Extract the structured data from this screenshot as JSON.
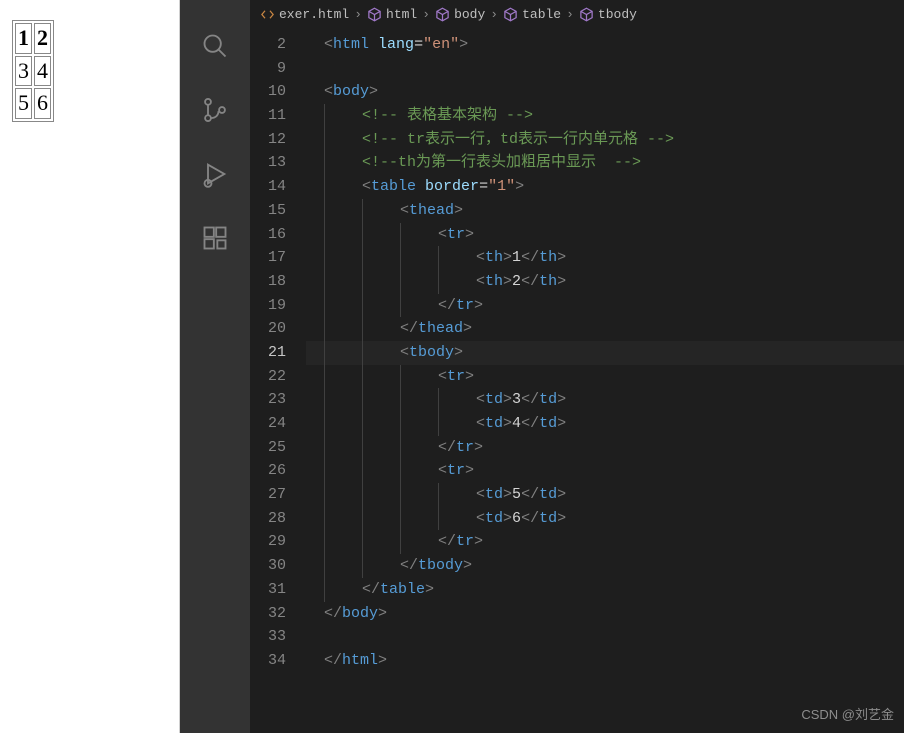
{
  "preview": {
    "table": {
      "header": [
        "1",
        "2"
      ],
      "rows": [
        [
          "3",
          "4"
        ],
        [
          "5",
          "6"
        ]
      ]
    }
  },
  "breadcrumb": {
    "file": "exer.html",
    "path": [
      "html",
      "body",
      "table",
      "tbody"
    ]
  },
  "activity": {
    "icons": [
      "search",
      "source-control",
      "run-debug",
      "extensions"
    ]
  },
  "editor": {
    "active_line": 21,
    "lines": [
      {
        "n": 2,
        "indent": 0,
        "tokens": [
          [
            "brkt",
            "<"
          ],
          [
            "tag",
            "html"
          ],
          [
            "txt",
            " "
          ],
          [
            "attr",
            "lang"
          ],
          [
            "eq",
            "="
          ],
          [
            "str",
            "\"en\""
          ],
          [
            "brkt",
            ">"
          ]
        ]
      },
      {
        "n": 9,
        "indent": 0,
        "tokens": []
      },
      {
        "n": 10,
        "indent": 0,
        "tokens": [
          [
            "brkt",
            "<"
          ],
          [
            "tag",
            "body"
          ],
          [
            "brkt",
            ">"
          ]
        ]
      },
      {
        "n": 11,
        "indent": 1,
        "tokens": [
          [
            "cmt",
            "<!-- 表格基本架构 -->"
          ]
        ]
      },
      {
        "n": 12,
        "indent": 1,
        "tokens": [
          [
            "cmt",
            "<!-- tr表示一行，td表示一行内单元格 -->"
          ]
        ]
      },
      {
        "n": 13,
        "indent": 1,
        "tokens": [
          [
            "cmt",
            "<!--th为第一行表头加粗居中显示  -->"
          ]
        ]
      },
      {
        "n": 14,
        "indent": 1,
        "tokens": [
          [
            "brkt",
            "<"
          ],
          [
            "tag",
            "table"
          ],
          [
            "txt",
            " "
          ],
          [
            "attr",
            "border"
          ],
          [
            "eq",
            "="
          ],
          [
            "str",
            "\"1\""
          ],
          [
            "brkt",
            ">"
          ]
        ]
      },
      {
        "n": 15,
        "indent": 2,
        "tokens": [
          [
            "brkt",
            "<"
          ],
          [
            "tag",
            "thead"
          ],
          [
            "brkt",
            ">"
          ]
        ]
      },
      {
        "n": 16,
        "indent": 3,
        "tokens": [
          [
            "brkt",
            "<"
          ],
          [
            "tag",
            "tr"
          ],
          [
            "brkt",
            ">"
          ]
        ]
      },
      {
        "n": 17,
        "indent": 4,
        "tokens": [
          [
            "brkt",
            "<"
          ],
          [
            "tag",
            "th"
          ],
          [
            "brkt",
            ">"
          ],
          [
            "txt",
            "1"
          ],
          [
            "brkt",
            "</"
          ],
          [
            "tag",
            "th"
          ],
          [
            "brkt",
            ">"
          ]
        ]
      },
      {
        "n": 18,
        "indent": 4,
        "tokens": [
          [
            "brkt",
            "<"
          ],
          [
            "tag",
            "th"
          ],
          [
            "brkt",
            ">"
          ],
          [
            "txt",
            "2"
          ],
          [
            "brkt",
            "</"
          ],
          [
            "tag",
            "th"
          ],
          [
            "brkt",
            ">"
          ]
        ]
      },
      {
        "n": 19,
        "indent": 3,
        "tokens": [
          [
            "brkt",
            "</"
          ],
          [
            "tag",
            "tr"
          ],
          [
            "brkt",
            ">"
          ]
        ]
      },
      {
        "n": 20,
        "indent": 2,
        "tokens": [
          [
            "brkt",
            "</"
          ],
          [
            "tag",
            "thead"
          ],
          [
            "brkt",
            ">"
          ]
        ]
      },
      {
        "n": 21,
        "indent": 2,
        "tokens": [
          [
            "brkt",
            "<"
          ],
          [
            "tag",
            "tbody"
          ],
          [
            "brkt",
            ">"
          ]
        ]
      },
      {
        "n": 22,
        "indent": 3,
        "tokens": [
          [
            "brkt",
            "<"
          ],
          [
            "tag",
            "tr"
          ],
          [
            "brkt",
            ">"
          ]
        ]
      },
      {
        "n": 23,
        "indent": 4,
        "tokens": [
          [
            "brkt",
            "<"
          ],
          [
            "tag",
            "td"
          ],
          [
            "brkt",
            ">"
          ],
          [
            "txt",
            "3"
          ],
          [
            "brkt",
            "</"
          ],
          [
            "tag",
            "td"
          ],
          [
            "brkt",
            ">"
          ]
        ]
      },
      {
        "n": 24,
        "indent": 4,
        "tokens": [
          [
            "brkt",
            "<"
          ],
          [
            "tag",
            "td"
          ],
          [
            "brkt",
            ">"
          ],
          [
            "txt",
            "4"
          ],
          [
            "brkt",
            "</"
          ],
          [
            "tag",
            "td"
          ],
          [
            "brkt",
            ">"
          ]
        ]
      },
      {
        "n": 25,
        "indent": 3,
        "tokens": [
          [
            "brkt",
            "</"
          ],
          [
            "tag",
            "tr"
          ],
          [
            "brkt",
            ">"
          ]
        ]
      },
      {
        "n": 26,
        "indent": 3,
        "tokens": [
          [
            "brkt",
            "<"
          ],
          [
            "tag",
            "tr"
          ],
          [
            "brkt",
            ">"
          ]
        ]
      },
      {
        "n": 27,
        "indent": 4,
        "tokens": [
          [
            "brkt",
            "<"
          ],
          [
            "tag",
            "td"
          ],
          [
            "brkt",
            ">"
          ],
          [
            "txt",
            "5"
          ],
          [
            "brkt",
            "</"
          ],
          [
            "tag",
            "td"
          ],
          [
            "brkt",
            ">"
          ]
        ]
      },
      {
        "n": 28,
        "indent": 4,
        "tokens": [
          [
            "brkt",
            "<"
          ],
          [
            "tag",
            "td"
          ],
          [
            "brkt",
            ">"
          ],
          [
            "txt",
            "6"
          ],
          [
            "brkt",
            "</"
          ],
          [
            "tag",
            "td"
          ],
          [
            "brkt",
            ">"
          ]
        ]
      },
      {
        "n": 29,
        "indent": 3,
        "tokens": [
          [
            "brkt",
            "</"
          ],
          [
            "tag",
            "tr"
          ],
          [
            "brkt",
            ">"
          ]
        ]
      },
      {
        "n": 30,
        "indent": 2,
        "tokens": [
          [
            "brkt",
            "</"
          ],
          [
            "tag",
            "tbody"
          ],
          [
            "brkt",
            ">"
          ]
        ]
      },
      {
        "n": 31,
        "indent": 1,
        "tokens": [
          [
            "brkt",
            "</"
          ],
          [
            "tag",
            "table"
          ],
          [
            "brkt",
            ">"
          ]
        ]
      },
      {
        "n": 32,
        "indent": 0,
        "tokens": [
          [
            "brkt",
            "</"
          ],
          [
            "tag",
            "body"
          ],
          [
            "brkt",
            ">"
          ]
        ]
      },
      {
        "n": 33,
        "indent": 0,
        "tokens": []
      },
      {
        "n": 34,
        "indent": 0,
        "tokens": [
          [
            "brkt",
            "</"
          ],
          [
            "tag",
            "html"
          ],
          [
            "brkt",
            ">"
          ]
        ]
      }
    ]
  },
  "watermark": "CSDN @刘艺金"
}
